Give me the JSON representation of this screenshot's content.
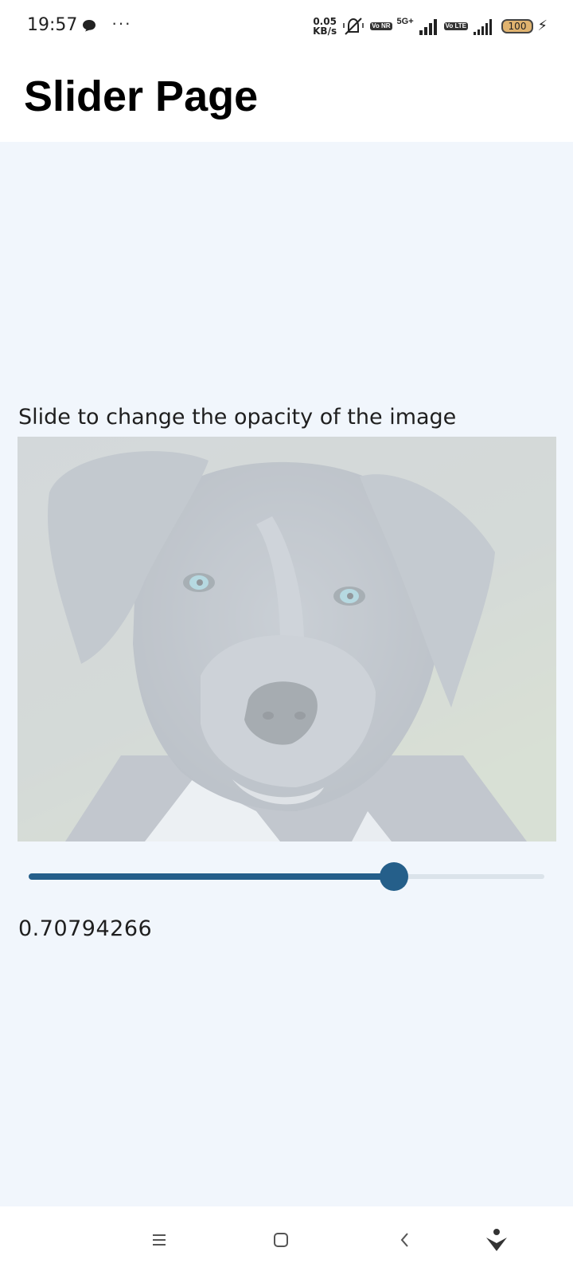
{
  "status_bar": {
    "time": "19:57",
    "network_speed_value": "0.05",
    "network_speed_unit": "KB/s",
    "badge_vonr": "Vo NR",
    "label_5g": "5G+",
    "badge_volte": "Vo LTE",
    "battery_level": "100",
    "icons": [
      "chat-bubble-icon",
      "more-dots-icon",
      "mute-icon",
      "signal-icon",
      "battery-icon",
      "charging-icon"
    ]
  },
  "app_bar": {
    "title": "Slider Page"
  },
  "main": {
    "caption": "Slide to change the opacity of the image",
    "image_alt": "Dog",
    "slider": {
      "value": 0.70794266,
      "min": 0,
      "max": 1
    },
    "value_text": "0.70794266"
  },
  "colors": {
    "accent": "#255f8a",
    "background": "#f1f6fc",
    "track": "#dbe3ea"
  },
  "nav_bar": {
    "icons": [
      "menu-icon",
      "home-icon",
      "back-icon",
      "assistant-icon"
    ]
  }
}
